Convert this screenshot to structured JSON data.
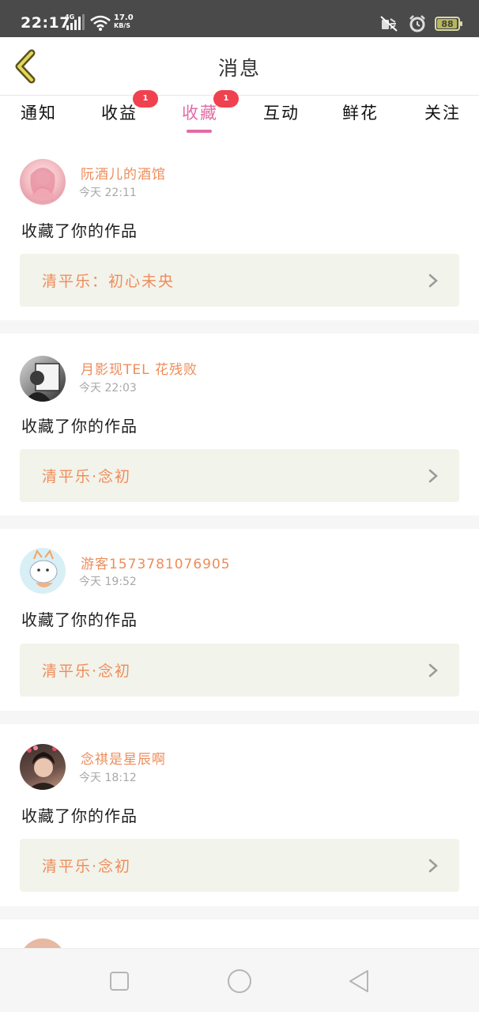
{
  "status_bar": {
    "time": "22:17",
    "network_type": "4G",
    "speed_value": "17.0",
    "speed_unit": "KB/S",
    "battery": "88",
    "icons": [
      "signal-icon",
      "wifi-icon",
      "mute-icon",
      "alarm-icon",
      "battery-icon"
    ]
  },
  "header": {
    "back_icon": "chevron-left-icon",
    "title": "消息"
  },
  "tabs": [
    {
      "label": "通知"
    },
    {
      "label": "收益",
      "badge": "1"
    },
    {
      "label": "收藏",
      "badge": "1",
      "active": true
    },
    {
      "label": "互动"
    },
    {
      "label": "鲜花"
    },
    {
      "label": "关注"
    }
  ],
  "notifications": [
    {
      "username": "阮酒儿的酒馆",
      "time": "今天 22:11",
      "action": "收藏了你的作品",
      "work": "清平乐：初心未央"
    },
    {
      "username": "月影现TEL 花残败",
      "time": "今天 22:03",
      "action": "收藏了你的作品",
      "work": "清平乐·念初"
    },
    {
      "username": "游客1573781076905",
      "time": "今天 19:52",
      "action": "收藏了你的作品",
      "work": "清平乐·念初"
    },
    {
      "username": "念祺是星辰啊",
      "time": "今天 18:12",
      "action": "收藏了你的作品",
      "work": "清平乐·念初"
    }
  ],
  "accent_colors": {
    "active_tab": "#e26ba6",
    "username": "#ee8c5a",
    "badge": "#f0414f"
  },
  "nav_bar": {
    "icons": [
      "recent-apps-icon",
      "home-icon",
      "back-triangle-icon"
    ]
  }
}
